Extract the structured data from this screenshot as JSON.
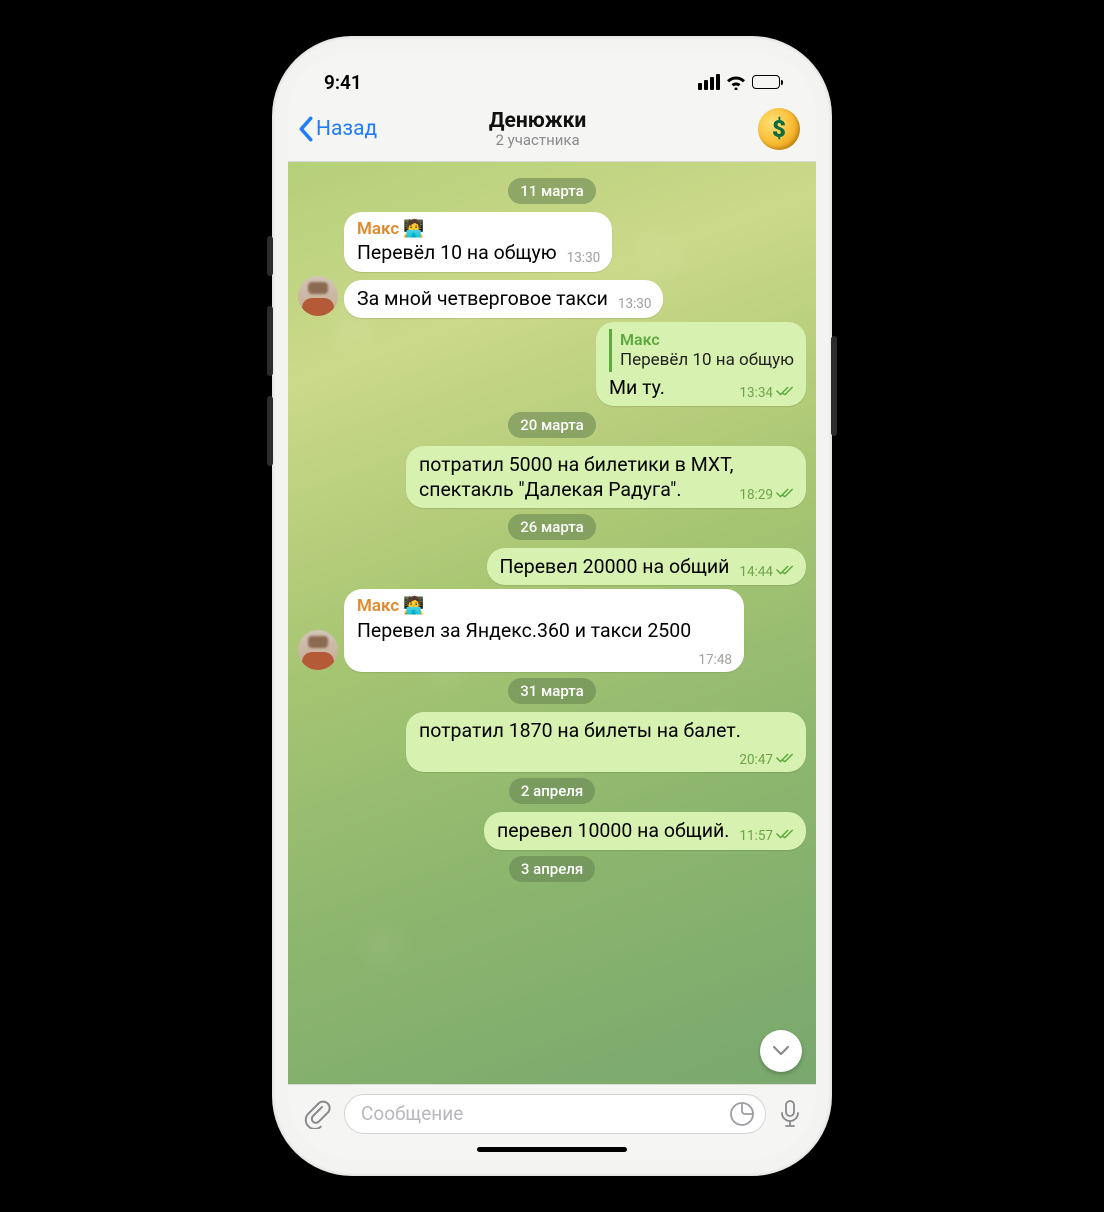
{
  "status": {
    "time": "9:41"
  },
  "nav": {
    "back_label": "Назад",
    "title": "Денюжки",
    "subtitle": "2 участника",
    "avatar_glyph": "$"
  },
  "dates": {
    "d0": "11 марта",
    "d1": "20 марта",
    "d2": "26 марта",
    "d3": "31 марта",
    "d4": "2 апреля",
    "d5": "3 апреля"
  },
  "sender_name": "Макс",
  "messages": {
    "m0": {
      "text": "Перевёл 10 на общую",
      "time": "13:30"
    },
    "m1": {
      "text": "За мной четверговое такси",
      "time": "13:30"
    },
    "m2": {
      "reply_name": "Макс",
      "reply_text": "Перевёл 10 на общую",
      "text": "Ми ту.",
      "time": "13:34"
    },
    "m3": {
      "text": "потратил 5000 на билетики в МХТ, спектакль \"Далекая Радуга\".",
      "time": "18:29"
    },
    "m4": {
      "text": "Перевел 20000 на общий",
      "time": "14:44"
    },
    "m5": {
      "text": "Перевел за Яндекс.360 и такси 2500",
      "time": "17:48"
    },
    "m6": {
      "text": "потратил 1870 на билеты на балет.",
      "time": "20:47"
    },
    "m7": {
      "text": "перевел 10000 на общий.",
      "time": "11:57"
    }
  },
  "input": {
    "placeholder": "Сообщение"
  }
}
